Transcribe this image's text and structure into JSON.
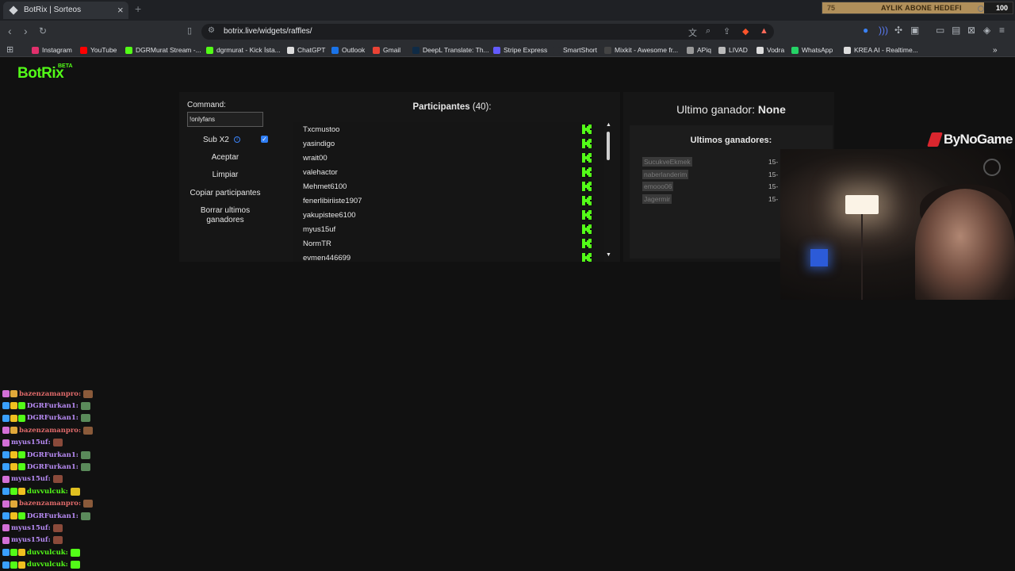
{
  "browser": {
    "tab_title": "BotRix | Sorteos",
    "tab_close_icon": "close-icon",
    "new_tab_symbol": "+",
    "url": "botrix.live/widgets/raffles/"
  },
  "goal": {
    "start": "75",
    "label": "AYLIK ABONE HEDEFI",
    "end": "100",
    "progress": 0.85,
    "fill_color": "#b08f5a"
  },
  "bookmarks": [
    {
      "label": "Instagram",
      "color": "#e1306c"
    },
    {
      "label": "YouTube",
      "color": "#ff0000"
    },
    {
      "label": "DGRMurat Stream -...",
      "color": "#53fc18"
    },
    {
      "label": "dgrmurat - Kick İsta...",
      "color": "#53fc18"
    },
    {
      "label": "ChatGPT",
      "color": "#dddddd"
    },
    {
      "label": "Outlook",
      "color": "#1a73e8"
    },
    {
      "label": "Gmail",
      "color": "#ea4335"
    },
    {
      "label": "DeepL Translate: Th...",
      "color": "#0f2b46"
    },
    {
      "label": "Stripe Express",
      "color": "#635bff"
    },
    {
      "label": "SmartShort",
      "color": "#2b2d31"
    },
    {
      "label": "Mixkit - Awesome fr...",
      "color": "#444444"
    },
    {
      "label": "APiq",
      "color": "#999999"
    },
    {
      "label": "LIVAD",
      "color": "#bbbbbb"
    },
    {
      "label": "Vodra",
      "color": "#dddddd"
    },
    {
      "label": "WhatsApp",
      "color": "#25d366"
    },
    {
      "label": "KREA AI - Realtime...",
      "color": "#dddddd"
    }
  ],
  "app": {
    "logo": "BotRix",
    "logo_badge": "BETA",
    "accent": "#53fc18"
  },
  "command": {
    "label": "Command:",
    "value": "!onlyfans",
    "sub_x2_label": "Sub X2",
    "sub_x2_checked": true,
    "accept": "Aceptar",
    "clear": "Limpiar",
    "copy": "Copiar participantes",
    "delete_winners": "Borrar ultimos ganadores"
  },
  "participants": {
    "title": "Participantes",
    "count": "(40)",
    "suffix": ":",
    "items": [
      "Txcmustoo",
      "yasindigo",
      "wrait00",
      "valehactor",
      "Mehmet6100",
      "fenerlibiriiste1907",
      "yakupistee6100",
      "myus15uf",
      "NormTR",
      "evmen446699"
    ]
  },
  "winners": {
    "last_label": "Ultimo ganador:",
    "last_value": "None",
    "title": "Ultimos ganadores:",
    "items": [
      {
        "name": "SucukveEkmek",
        "date": "15-"
      },
      {
        "name": "naberlanderim",
        "date": "15-"
      },
      {
        "name": "emooo06",
        "date": "15-"
      },
      {
        "name": "Jagermir",
        "date": "15-"
      }
    ]
  },
  "overlay": {
    "brand": "ByNoGame"
  },
  "chat": [
    {
      "user": "bazenzamanpro:",
      "color": "#e06a6a",
      "badges": [
        "#d36fd6",
        "#e0a83a"
      ],
      "emote": "#8a5a3a"
    },
    {
      "user": "DGRFurkan1:",
      "color": "#b88bf5",
      "badges": [
        "#3aa0ff",
        "#f0c020",
        "#53fc18"
      ],
      "emote": "#5a8a5a"
    },
    {
      "user": "DGRFurkan1:",
      "color": "#b88bf5",
      "badges": [
        "#3aa0ff",
        "#f0c020",
        "#53fc18"
      ],
      "emote": "#5a8a5a"
    },
    {
      "user": "bazenzamanpro:",
      "color": "#e06a6a",
      "badges": [
        "#d36fd6",
        "#e0a83a"
      ],
      "emote": "#8a5a3a"
    },
    {
      "user": "myus15uf:",
      "color": "#b88bf5",
      "badges": [
        "#d36fd6"
      ],
      "emote": "#8a4a3a"
    },
    {
      "user": "DGRFurkan1:",
      "color": "#b88bf5",
      "badges": [
        "#3aa0ff",
        "#f0c020",
        "#53fc18"
      ],
      "emote": "#5a8a5a"
    },
    {
      "user": "DGRFurkan1:",
      "color": "#b88bf5",
      "badges": [
        "#3aa0ff",
        "#f0c020",
        "#53fc18"
      ],
      "emote": "#5a8a5a"
    },
    {
      "user": "myus15uf:",
      "color": "#b88bf5",
      "badges": [
        "#d36fd6"
      ],
      "emote": "#8a4a3a"
    },
    {
      "user": "duvvulcuk:",
      "color": "#53fc18",
      "badges": [
        "#3aa0ff",
        "#53fc18",
        "#f0c020"
      ],
      "emote": "#e0c020"
    },
    {
      "user": "bazenzamanpro:",
      "color": "#e06a6a",
      "badges": [
        "#d36fd6",
        "#e0a83a"
      ],
      "emote": "#8a5a3a"
    },
    {
      "user": "DGRFurkan1:",
      "color": "#b88bf5",
      "badges": [
        "#3aa0ff",
        "#f0c020",
        "#53fc18"
      ],
      "emote": "#5a8a5a"
    },
    {
      "user": "myus15uf:",
      "color": "#b88bf5",
      "badges": [
        "#d36fd6"
      ],
      "emote": "#8a4a3a"
    },
    {
      "user": "myus15uf:",
      "color": "#b88bf5",
      "badges": [
        "#d36fd6"
      ],
      "emote": "#8a4a3a"
    },
    {
      "user": "duvvulcuk:",
      "color": "#53fc18",
      "badges": [
        "#3aa0ff",
        "#53fc18",
        "#f0c020"
      ],
      "emote": "#53fc18"
    },
    {
      "user": "duvvulcuk:",
      "color": "#53fc18",
      "badges": [
        "#3aa0ff",
        "#53fc18",
        "#f0c020"
      ],
      "emote": "#53fc18"
    }
  ]
}
